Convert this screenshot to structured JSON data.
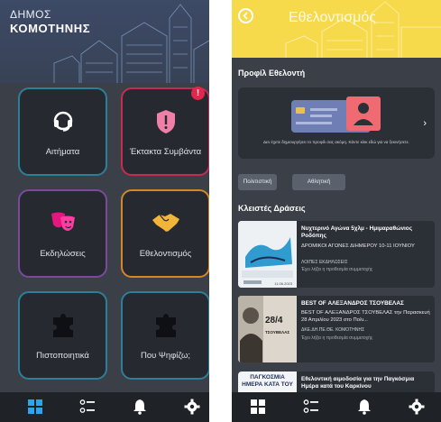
{
  "left": {
    "header": {
      "line1": "ΔΗΜΟΣ",
      "line2": "ΚΟΜΟΤΗΝΗΣ"
    },
    "tiles": [
      {
        "label": "Αιτήματα",
        "icon": "headset-icon",
        "border": "#2d7f98"
      },
      {
        "label": "Έκτακτα Συμβάντα",
        "icon": "shield-alert-icon",
        "border": "#c72a52",
        "badge": "!"
      },
      {
        "label": "Εκδηλώσεις",
        "icon": "theater-masks-icon",
        "border": "#7b4a9a"
      },
      {
        "label": "Εθελοντισμός",
        "icon": "handshake-icon",
        "border": "#d4862a"
      },
      {
        "label": "Πιστοποιητικά",
        "icon": "puzzle-icon",
        "border": "#2d7f98"
      },
      {
        "label": "Που Ψηφίζω;",
        "icon": "puzzle-icon",
        "border": "#2d7f98"
      }
    ],
    "nav": [
      "grid-icon",
      "checklist-icon",
      "bell-icon",
      "gear-icon"
    ]
  },
  "right": {
    "header": {
      "title": "Εθελοντισμός"
    },
    "profile_section": "Προφίλ Εθελοντή",
    "profile_text": "Δεν έχετε δημιουργήσει το προφίλ σας ακόμη. Κάντε κλικ εδώ για να ξεκινήσετε.",
    "chips": [
      "Πολιτιστική",
      "Αθλητική"
    ],
    "closed_section": "Κλειστές Δράσεις",
    "cards": [
      {
        "title": "Νυχτερινό Αγώνα 5χλμ - Ημιμαραθώνιος Ροδόπης",
        "subtitle": "ΔΡΟΜΙΚΟΙ ΑΓΩΝΕΣ ΔΙΗΜΕΡΟΥ 10-11 ΙΟΥΝΙΟΥ",
        "meta": "ΛΟΙΠΕΣ ΕΚΔΗΛΩΣΕΙΣ",
        "footer": "Έχει λήξει η προθεσμία συμμετοχής",
        "thumb_date": "11.06.2023"
      },
      {
        "title": "BEST OF  ΑΛΕΞΑΝΔΡΟΣ ΤΣΟΥΒΕΛΑΣ",
        "subtitle": "BEST OF ΑΛΕΞΑΝΔΡΟΣ ΤΣΟΥΒΕΛΑΣ την Παρασκευή 28 Απριλίου 2023 στο Πολι...",
        "meta": "ΔΚΕ.ΔΗ.ΠΕ.ΘΕ. ΚΟΜΟΤΗΝΗΣ",
        "footer": "Έχει λήξει η προθεσμία συμμετοχής",
        "thumb_text": "28/4",
        "thumb_sub": "ΤΣΟΥΒΕΛΑΣ"
      },
      {
        "title": "Εθελοντική αιμοδοσία για την Παγκόσμια Ημέρα κατά του Καρκίνου",
        "thumb_text": "ΠΑΓΚΟΣΜΙΑ ΗΜΕΡΑ ΚΑΤΑ ΤΟΥ"
      }
    ],
    "nav": [
      "grid-icon",
      "checklist-icon",
      "bell-icon",
      "gear-icon"
    ]
  }
}
